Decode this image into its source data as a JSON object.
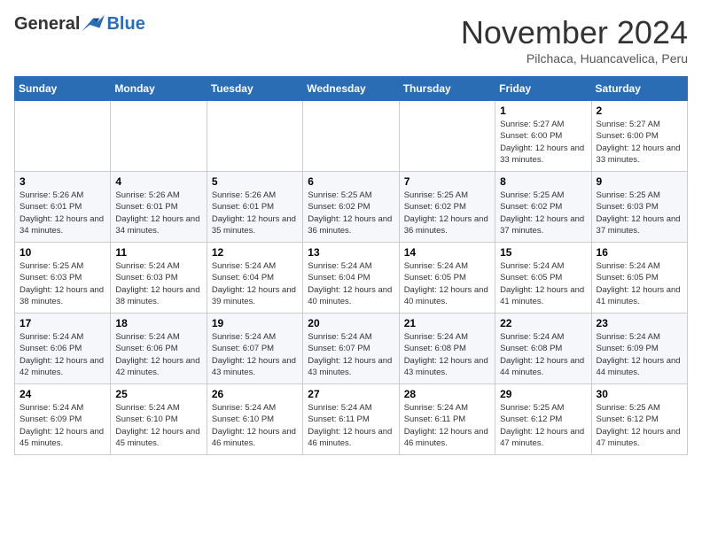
{
  "header": {
    "logo_general": "General",
    "logo_blue": "Blue",
    "month_title": "November 2024",
    "subtitle": "Pilchaca, Huancavelica, Peru"
  },
  "calendar": {
    "days_of_week": [
      "Sunday",
      "Monday",
      "Tuesday",
      "Wednesday",
      "Thursday",
      "Friday",
      "Saturday"
    ],
    "weeks": [
      [
        {
          "day": "",
          "info": ""
        },
        {
          "day": "",
          "info": ""
        },
        {
          "day": "",
          "info": ""
        },
        {
          "day": "",
          "info": ""
        },
        {
          "day": "",
          "info": ""
        },
        {
          "day": "1",
          "info": "Sunrise: 5:27 AM\nSunset: 6:00 PM\nDaylight: 12 hours and 33 minutes."
        },
        {
          "day": "2",
          "info": "Sunrise: 5:27 AM\nSunset: 6:00 PM\nDaylight: 12 hours and 33 minutes."
        }
      ],
      [
        {
          "day": "3",
          "info": "Sunrise: 5:26 AM\nSunset: 6:01 PM\nDaylight: 12 hours and 34 minutes."
        },
        {
          "day": "4",
          "info": "Sunrise: 5:26 AM\nSunset: 6:01 PM\nDaylight: 12 hours and 34 minutes."
        },
        {
          "day": "5",
          "info": "Sunrise: 5:26 AM\nSunset: 6:01 PM\nDaylight: 12 hours and 35 minutes."
        },
        {
          "day": "6",
          "info": "Sunrise: 5:25 AM\nSunset: 6:02 PM\nDaylight: 12 hours and 36 minutes."
        },
        {
          "day": "7",
          "info": "Sunrise: 5:25 AM\nSunset: 6:02 PM\nDaylight: 12 hours and 36 minutes."
        },
        {
          "day": "8",
          "info": "Sunrise: 5:25 AM\nSunset: 6:02 PM\nDaylight: 12 hours and 37 minutes."
        },
        {
          "day": "9",
          "info": "Sunrise: 5:25 AM\nSunset: 6:03 PM\nDaylight: 12 hours and 37 minutes."
        }
      ],
      [
        {
          "day": "10",
          "info": "Sunrise: 5:25 AM\nSunset: 6:03 PM\nDaylight: 12 hours and 38 minutes."
        },
        {
          "day": "11",
          "info": "Sunrise: 5:24 AM\nSunset: 6:03 PM\nDaylight: 12 hours and 38 minutes."
        },
        {
          "day": "12",
          "info": "Sunrise: 5:24 AM\nSunset: 6:04 PM\nDaylight: 12 hours and 39 minutes."
        },
        {
          "day": "13",
          "info": "Sunrise: 5:24 AM\nSunset: 6:04 PM\nDaylight: 12 hours and 40 minutes."
        },
        {
          "day": "14",
          "info": "Sunrise: 5:24 AM\nSunset: 6:05 PM\nDaylight: 12 hours and 40 minutes."
        },
        {
          "day": "15",
          "info": "Sunrise: 5:24 AM\nSunset: 6:05 PM\nDaylight: 12 hours and 41 minutes."
        },
        {
          "day": "16",
          "info": "Sunrise: 5:24 AM\nSunset: 6:05 PM\nDaylight: 12 hours and 41 minutes."
        }
      ],
      [
        {
          "day": "17",
          "info": "Sunrise: 5:24 AM\nSunset: 6:06 PM\nDaylight: 12 hours and 42 minutes."
        },
        {
          "day": "18",
          "info": "Sunrise: 5:24 AM\nSunset: 6:06 PM\nDaylight: 12 hours and 42 minutes."
        },
        {
          "day": "19",
          "info": "Sunrise: 5:24 AM\nSunset: 6:07 PM\nDaylight: 12 hours and 43 minutes."
        },
        {
          "day": "20",
          "info": "Sunrise: 5:24 AM\nSunset: 6:07 PM\nDaylight: 12 hours and 43 minutes."
        },
        {
          "day": "21",
          "info": "Sunrise: 5:24 AM\nSunset: 6:08 PM\nDaylight: 12 hours and 43 minutes."
        },
        {
          "day": "22",
          "info": "Sunrise: 5:24 AM\nSunset: 6:08 PM\nDaylight: 12 hours and 44 minutes."
        },
        {
          "day": "23",
          "info": "Sunrise: 5:24 AM\nSunset: 6:09 PM\nDaylight: 12 hours and 44 minutes."
        }
      ],
      [
        {
          "day": "24",
          "info": "Sunrise: 5:24 AM\nSunset: 6:09 PM\nDaylight: 12 hours and 45 minutes."
        },
        {
          "day": "25",
          "info": "Sunrise: 5:24 AM\nSunset: 6:10 PM\nDaylight: 12 hours and 45 minutes."
        },
        {
          "day": "26",
          "info": "Sunrise: 5:24 AM\nSunset: 6:10 PM\nDaylight: 12 hours and 46 minutes."
        },
        {
          "day": "27",
          "info": "Sunrise: 5:24 AM\nSunset: 6:11 PM\nDaylight: 12 hours and 46 minutes."
        },
        {
          "day": "28",
          "info": "Sunrise: 5:24 AM\nSunset: 6:11 PM\nDaylight: 12 hours and 46 minutes."
        },
        {
          "day": "29",
          "info": "Sunrise: 5:25 AM\nSunset: 6:12 PM\nDaylight: 12 hours and 47 minutes."
        },
        {
          "day": "30",
          "info": "Sunrise: 5:25 AM\nSunset: 6:12 PM\nDaylight: 12 hours and 47 minutes."
        }
      ]
    ]
  }
}
